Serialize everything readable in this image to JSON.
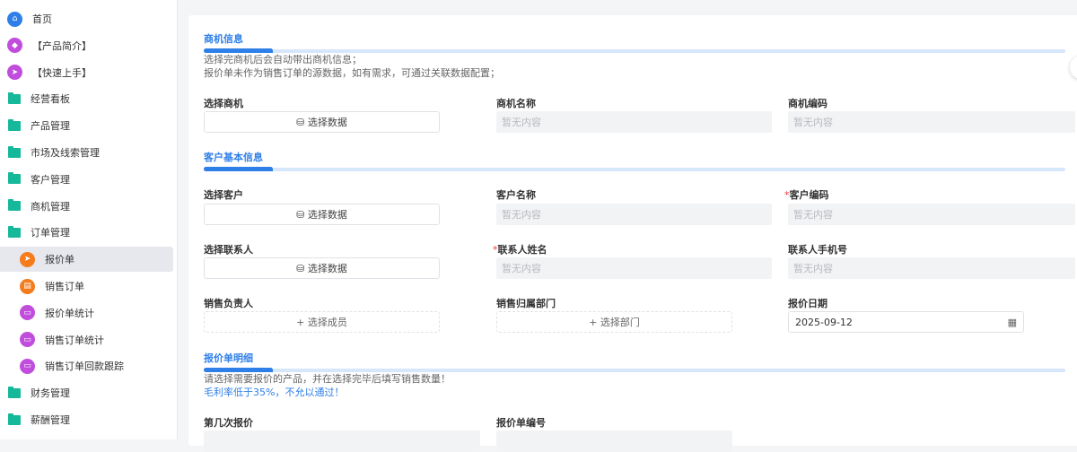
{
  "sidebar": {
    "items": [
      {
        "label": "首页",
        "icon": "home-icon",
        "color": "#2f7fe8"
      },
      {
        "label": "【产品简介】",
        "icon": "tag-icon",
        "color": "#c04ddc"
      },
      {
        "label": "【快速上手】",
        "icon": "send-icon",
        "color": "#c04ddc"
      },
      {
        "label": "经营看板",
        "icon": "folder-icon"
      },
      {
        "label": "产品管理",
        "icon": "folder-icon"
      },
      {
        "label": "市场及线索管理",
        "icon": "folder-icon"
      },
      {
        "label": "客户管理",
        "icon": "folder-icon"
      },
      {
        "label": "商机管理",
        "icon": "folder-icon"
      },
      {
        "label": "订单管理",
        "icon": "folder-open-icon"
      },
      {
        "label": "报价单",
        "icon": "send-icon",
        "color": "#f47c1c",
        "active": true
      },
      {
        "label": "销售订单",
        "icon": "clipboard-icon",
        "color": "#f47c1c"
      },
      {
        "label": "报价单统计",
        "icon": "monitor-chart-icon",
        "color": "#c04ddc"
      },
      {
        "label": "销售订单统计",
        "icon": "monitor-chart-icon",
        "color": "#c04ddc"
      },
      {
        "label": "销售订单回款跟踪",
        "icon": "monitor-chart-icon",
        "color": "#c04ddc"
      },
      {
        "label": "财务管理",
        "icon": "folder-icon"
      },
      {
        "label": "薪酬管理",
        "icon": "folder-icon"
      }
    ]
  },
  "form": {
    "sec1": {
      "title": "商机信息",
      "note1": "选择完商机后会自动带出商机信息；",
      "note2": "报价单未作为销售订单的源数据，如有需求，可通过关联数据配置；"
    },
    "select_opportunity": "选择商机",
    "opportunity_name": "商机名称",
    "opportunity_code": "商机编码",
    "select_data": "选择数据",
    "empty": "暂无内容",
    "sec2": {
      "title": "客户基本信息"
    },
    "select_customer": "选择客户",
    "customer_name": "客户名称",
    "customer_code": "客户编码",
    "select_contact": "选择联系人",
    "contact_name": "联系人姓名",
    "contact_phone": "联系人手机号",
    "sales_owner": "销售负责人",
    "select_member": "+ 选择成员",
    "sales_dept": "销售归属部门",
    "select_dept": "+ 选择部门",
    "quote_date": "报价日期",
    "quote_date_value": "2025-09-12",
    "sec3": {
      "title": "报价单明细",
      "note1": "请选择需要报价的产品，并在选择完毕后填写销售数量！",
      "note2": "毛利率低于35%，不允以通过！"
    },
    "quote_round": "第几次报价",
    "quote_no": "报价单编号",
    "required_mark": "*"
  }
}
